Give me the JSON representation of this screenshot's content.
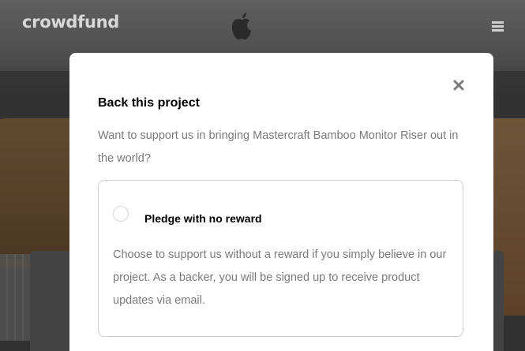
{
  "header": {
    "logo": "crowdfund",
    "menu_icon": "hamburger-icon",
    "brand_icon": "apple-logo-icon"
  },
  "modal": {
    "close_icon": "close-icon",
    "title": "Back this project",
    "description": "Want to support us in bringing Mastercraft Bamboo Monitor Riser out in the world?",
    "options": [
      {
        "title": "Pledge with no reward",
        "description": "Choose to support us without a reward if you simply believe in our project. As a backer, you will be signed up to receive product updates via email.",
        "selected": false
      }
    ]
  },
  "colors": {
    "title": "#000000",
    "body_text": "#7a7a7a",
    "border": "#cfcfcf",
    "modal_bg": "#ffffff",
    "overlay": "rgba(0,0,0,0.45)"
  }
}
